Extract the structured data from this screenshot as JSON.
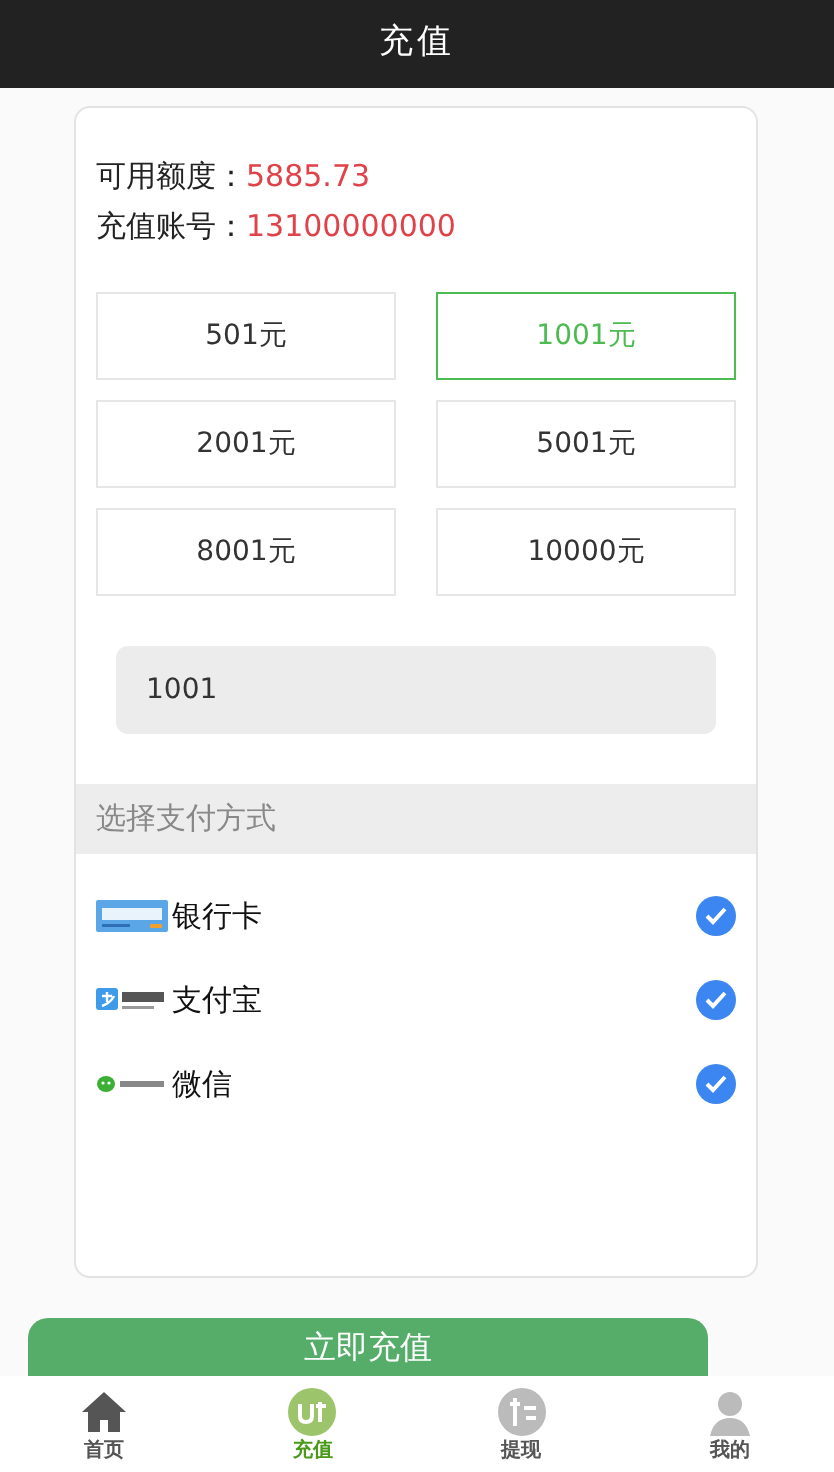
{
  "header": {
    "title": "充值"
  },
  "info": [
    {
      "label": "可用额度：",
      "value": "5885.73"
    },
    {
      "label": "充值账号：",
      "value": "13100000000"
    }
  ],
  "amounts": [
    {
      "label": "501元",
      "selected": false
    },
    {
      "label": "1001元",
      "selected": true
    },
    {
      "label": "2001元",
      "selected": false
    },
    {
      "label": "5001元",
      "selected": false
    },
    {
      "label": "8001元",
      "selected": false
    },
    {
      "label": "10000元",
      "selected": false
    }
  ],
  "amount_field": {
    "value": "1001"
  },
  "payment_section": {
    "title": "选择支付方式"
  },
  "payment_methods": [
    {
      "kind": "bank",
      "label": "银行卡",
      "checked": true
    },
    {
      "kind": "alipay",
      "label": "支付宝",
      "checked": true
    },
    {
      "kind": "wechat",
      "label": "微信",
      "checked": true
    }
  ],
  "submit_button": {
    "label": "立即充值"
  },
  "bottom_nav": [
    {
      "kind": "home",
      "label": "首页",
      "selected": false
    },
    {
      "kind": "recharge",
      "label": "充值",
      "selected": true
    },
    {
      "kind": "withdraw",
      "label": "提现",
      "selected": false
    },
    {
      "kind": "profile",
      "label": "我的",
      "selected": false
    }
  ]
}
